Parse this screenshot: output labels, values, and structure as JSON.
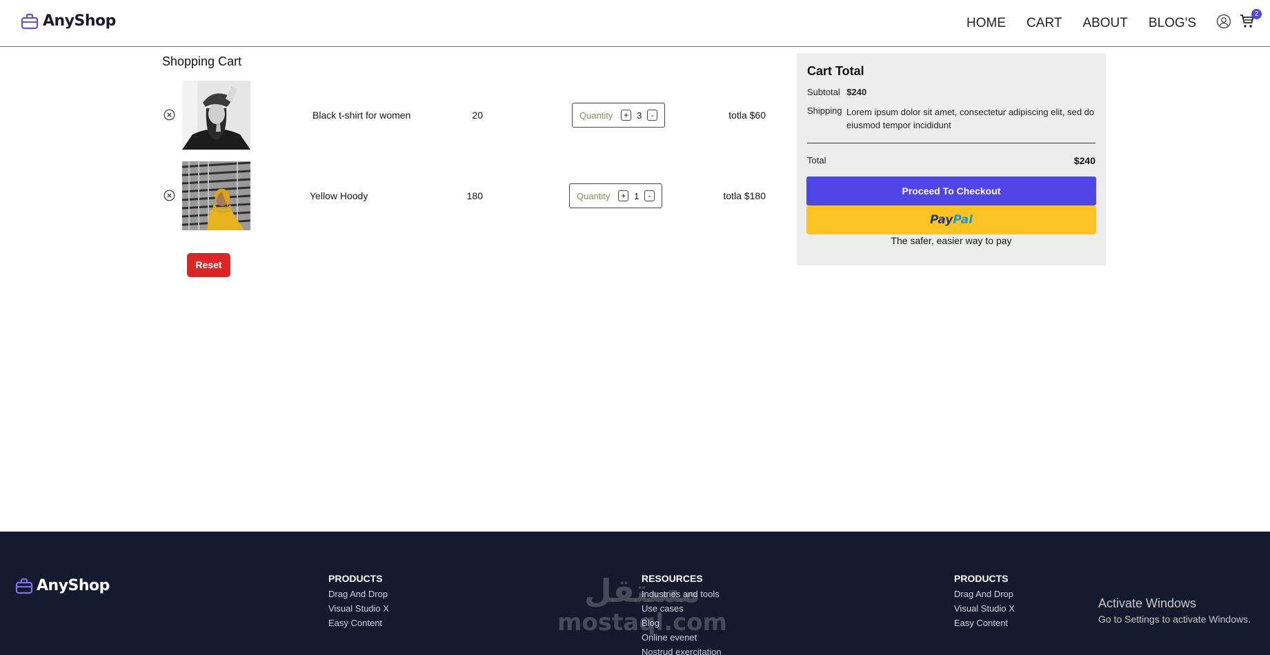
{
  "header": {
    "brand": "AnyShop",
    "nav": [
      "HOME",
      "CART",
      "ABOUT",
      "BLOG'S"
    ],
    "cart_count": "2"
  },
  "cart": {
    "title": "Shopping Cart",
    "items": [
      {
        "name": "Black t-shirt for women",
        "price": "20",
        "quantity_label": "Quantity",
        "quantity": "3",
        "total": "totla $60"
      },
      {
        "name": "Yellow Hoody",
        "price": "180",
        "quantity_label": "Quantity",
        "quantity": "1",
        "total": "totla $180"
      }
    ],
    "reset_label": "Reset"
  },
  "summary": {
    "title": "Cart Total",
    "subtotal_label": "Subtotal",
    "subtotal_value": "$240",
    "shipping_label": "Shipping",
    "shipping_text": "Lorem ipsum dolor sit amet, consectetur adipiscing elit, sed do eiusmod tempor incididunt",
    "total_label": "Total",
    "total_value": "$240",
    "checkout_label": "Proceed To Checkout",
    "paypal_pay": "Pay",
    "paypal_pal": "Pal",
    "paypal_tagline": "The safer, easier way to pay"
  },
  "footer": {
    "brand": "AnyShop",
    "columns": [
      {
        "title": "PRODUCTS",
        "links": [
          "Drag And Drop",
          "Visual Studio X",
          "Easy Content"
        ]
      },
      {
        "title": "RESOURCES",
        "links": [
          "Industries and tools",
          "Use cases",
          "Blog",
          "Online evenet",
          "Nostrud exercitation"
        ]
      },
      {
        "title": "PRODUCTS",
        "links": [
          "Drag And Drop",
          "Visual Studio X",
          "Easy Content"
        ]
      }
    ],
    "watermark_arabic": "مستقل",
    "watermark_latin": "mostaql.com"
  },
  "os_overlay": {
    "title": "Activate Windows",
    "subtitle": "Go to Settings to activate Windows."
  },
  "colors": {
    "accent": "#4f46e5",
    "reset": "#dc2626",
    "paypal": "#fbc323",
    "footer_bg": "#151a2e",
    "panel_bg": "#ededed"
  },
  "icons": [
    "briefcase-icon",
    "user-icon",
    "cart-icon",
    "remove-circle-icon"
  ]
}
